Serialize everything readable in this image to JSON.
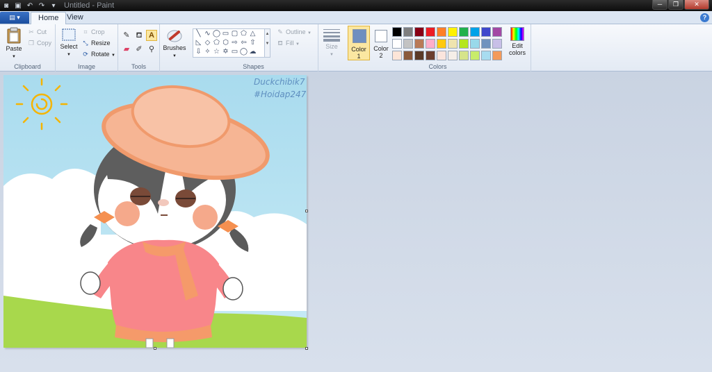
{
  "window": {
    "title": "Untitled - Paint",
    "buttons": {
      "minimize": "─",
      "maximize": "❐",
      "close": "✕"
    }
  },
  "tabs": [
    {
      "label": "Home",
      "active": true
    },
    {
      "label": "View",
      "active": false
    }
  ],
  "file_menu_icon": "paint-menu-icon",
  "help_icon": "?",
  "ribbon": {
    "clipboard": {
      "label": "Clipboard",
      "paste": "Paste",
      "cut": "Cut",
      "copy": "Copy"
    },
    "image": {
      "label": "Image",
      "select": "Select",
      "crop": "Crop",
      "resize": "Resize",
      "rotate": "Rotate"
    },
    "tools": {
      "label": "Tools"
    },
    "brushes": {
      "label": "Brushes"
    },
    "shapes": {
      "label": "Shapes",
      "outline": "Outline",
      "fill": "Fill"
    },
    "size": {
      "label": "Size"
    },
    "color1": {
      "label": "Color",
      "num": "1",
      "value": "#6f8fbf"
    },
    "color2": {
      "label": "Color",
      "num": "2",
      "value": "#ffffff"
    },
    "colors": {
      "label": "Colors",
      "edit_line1": "Edit",
      "edit_line2": "colors"
    }
  },
  "palette": {
    "row1": [
      "#000000",
      "#7f7f7f",
      "#880015",
      "#ed1c24",
      "#ff7f27",
      "#fff200",
      "#22b14c",
      "#00a2e8",
      "#3f48cc",
      "#a349a4"
    ],
    "row2": [
      "#ffffff",
      "#c3c3c3",
      "#b97a57",
      "#ffaec9",
      "#ffc90e",
      "#efe4b0",
      "#b5e61d",
      "#99d9ea",
      "#7092be",
      "#c8bfe7"
    ],
    "row3": [
      "#fde5d8",
      "#8a5a3c",
      "#5a3a28",
      "#6b3e2e",
      "#fbe5dd",
      "#f5eee8",
      "#d6e48a",
      "#c8ec6a",
      "#a8dcf0",
      "#f49a5a"
    ]
  },
  "artwork": {
    "watermark_line1": "Duckchibik7",
    "watermark_line2": "#Hoidap247"
  }
}
